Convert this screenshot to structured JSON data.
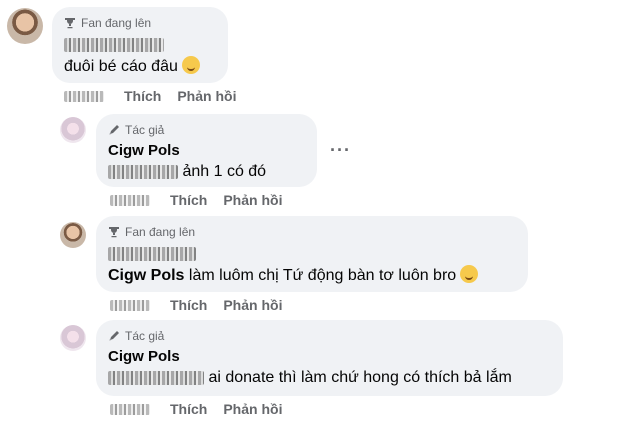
{
  "comments": [
    {
      "badge": "Fan đang lên",
      "badge_icon": "trophy-icon",
      "author_blurred": true,
      "text": "đuôi bé cáo đâu",
      "emoji": "smiling-face-emoji",
      "like_label": "Thích",
      "reply_label": "Phản hồi"
    },
    {
      "badge": "Tác giả",
      "badge_icon": "pencil-icon",
      "author": "Cigw Pols",
      "text": "ảnh 1 có đó",
      "more_label": "···",
      "like_label": "Thích",
      "reply_label": "Phản hồi"
    },
    {
      "badge": "Fan đang lên",
      "badge_icon": "trophy-icon",
      "author_blurred": true,
      "mention": "Cigw Pols",
      "text": "làm luôm chị Tứ động bàn tơ luôn bro",
      "emoji": "smiling-face-emoji",
      "like_label": "Thích",
      "reply_label": "Phản hồi"
    },
    {
      "badge": "Tác giả",
      "badge_icon": "pencil-icon",
      "author": "Cigw Pols",
      "text": "ai donate thì làm chứ hong có thích bả lắm",
      "like_label": "Thích",
      "reply_label": "Phản hồi"
    }
  ],
  "colors": {
    "bubble": "#f0f2f5",
    "secondary_text": "#65676b",
    "primary_text": "#050505"
  }
}
